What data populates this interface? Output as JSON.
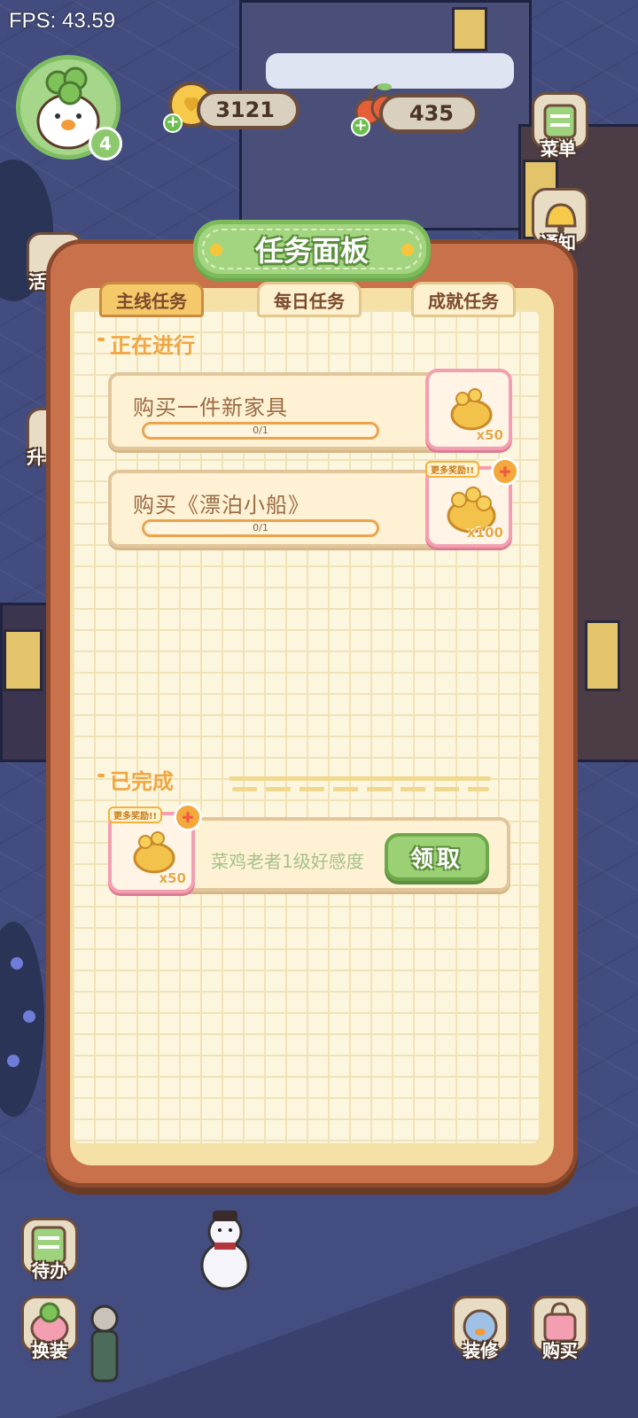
{
  "fps": "FPS: 43.59",
  "player": {
    "level": "4"
  },
  "resources": {
    "coins": "3121",
    "gems": "435"
  },
  "side_buttons": {
    "menu": "菜单",
    "notify": "通知",
    "activity": "活",
    "upgrade": "升",
    "todo": "待办",
    "dressup": "换装",
    "renovate": "装修",
    "shop": "购买"
  },
  "panel": {
    "title": "任务面板",
    "tabs": [
      {
        "label": "主线任务",
        "active": true
      },
      {
        "label": "每日任务",
        "active": false
      },
      {
        "label": "成就任务",
        "active": false
      }
    ],
    "in_progress": {
      "heading": "正在进行",
      "tasks": [
        {
          "name": "购买一件新家具",
          "progress": "0/1",
          "progress_value": 0,
          "reward_qty": "x50",
          "more_rewards": false
        },
        {
          "name": "购买《漂泊小船》",
          "progress": "0/1",
          "progress_value": 0,
          "reward_qty": "x100",
          "more_rewards": true,
          "more_label": "更多奖励!!"
        }
      ]
    },
    "completed": {
      "heading": "已完成",
      "tasks": [
        {
          "name": "菜鸡老者1级好感度",
          "reward_qty": "x50",
          "more_label": "更多奖励!!",
          "claim_label": "领取"
        }
      ]
    }
  },
  "colors": {
    "panel_frame": "#c9714b",
    "paper": "#fdf6df",
    "title_green": "#a3d47f",
    "accent_orange": "#f0a641",
    "reward_pink": "#f39fb1",
    "claim_green": "#9bd174"
  }
}
